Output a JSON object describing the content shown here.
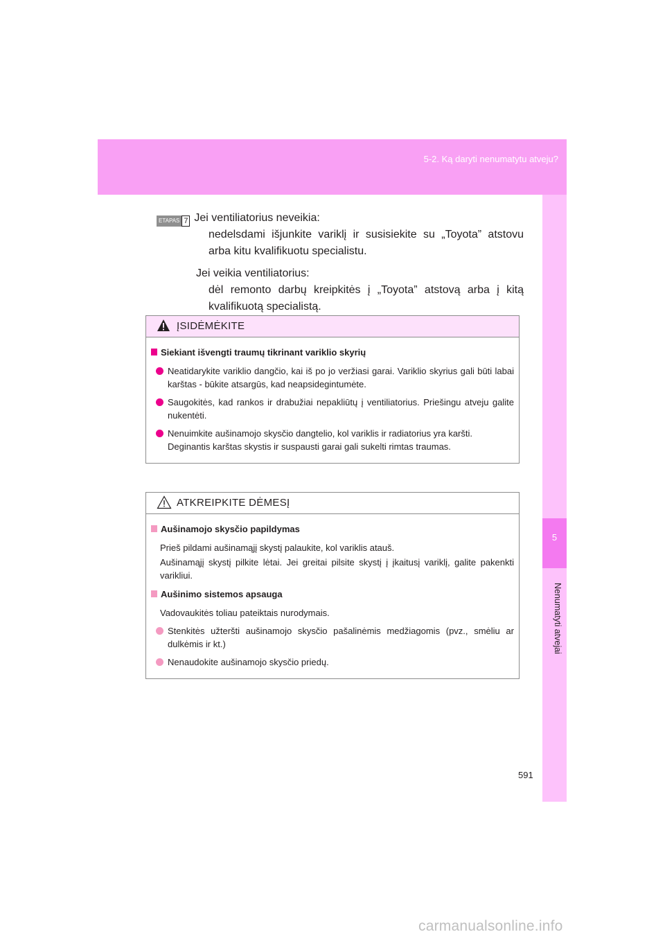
{
  "header": {
    "section": "5-2. Ką daryti nenumatytu atveju?"
  },
  "side_tab": {
    "chapter_number": "5",
    "chapter_label": "Nenumatyti atvejai"
  },
  "page_number": "591",
  "step": {
    "badge_word": "ETAPAS",
    "badge_number": "7",
    "condition1": "Jei ventiliatorius neveikia:",
    "action1": "nedelsdami išjunkite variklį ir susisiekite su „Toyota” atstovu arba kitu kvalifikuotu specialistu.",
    "condition2": "Jei veikia ventiliatorius:",
    "action2": "dėl remonto darbų kreipkitės į „Toyota” atstovą arba į kitą kvalifikuotą specialistą."
  },
  "caution": {
    "title": "ĮSIDĖMĖKITE",
    "heading": "Siekiant išvengti traumų tikrinant variklio skyrių",
    "items": [
      "Neatidarykite variklio dangčio, kai iš po jo veržiasi garai. Variklio skyrius gali būti labai karštas - būkite atsargūs, kad neapsidegintumėte.",
      "Saugokitės, kad rankos ir drabužiai nepakliūtų į ventiliatorius. Priešingu atveju galite nukentėti.",
      "Nenuimkite aušinamojo skysčio dangtelio, kol variklis ir radiatorius yra karšti."
    ],
    "item3_extra": "Deginantis karštas skystis ir suspausti garai gali sukelti rimtas traumas."
  },
  "notice": {
    "title": "ATKREIPKITE DĖMESĮ",
    "section1": {
      "heading": "Aušinamojo skysčio papildymas",
      "para1": "Prieš pildami aušinamąjį skystį palaukite, kol variklis atauš.",
      "para2": "Aušinamąjį skystį pilkite lėtai. Jei greitai pilsite skystį į įkaitusį variklį, galite pakenkti varikliui."
    },
    "section2": {
      "heading": "Aušinimo sistemos apsauga",
      "para": "Vadovaukitės toliau pateiktais nurodymais.",
      "items": [
        "Stenkitės užteršti aušinamojo skysčio pašalinėmis medžiagomis (pvz., smėliu ar dulkėmis ir kt.)",
        "Nenaudokite aušinamojo skysčio priedų."
      ]
    }
  },
  "watermark": "carmanualsonline.info",
  "colors": {
    "header_band": "#f9a0f4",
    "side_tab": "#fdc2fb",
    "chapter_block": "#f47af0",
    "caution_head": "#fde1fb",
    "accent": "#ec008c"
  }
}
